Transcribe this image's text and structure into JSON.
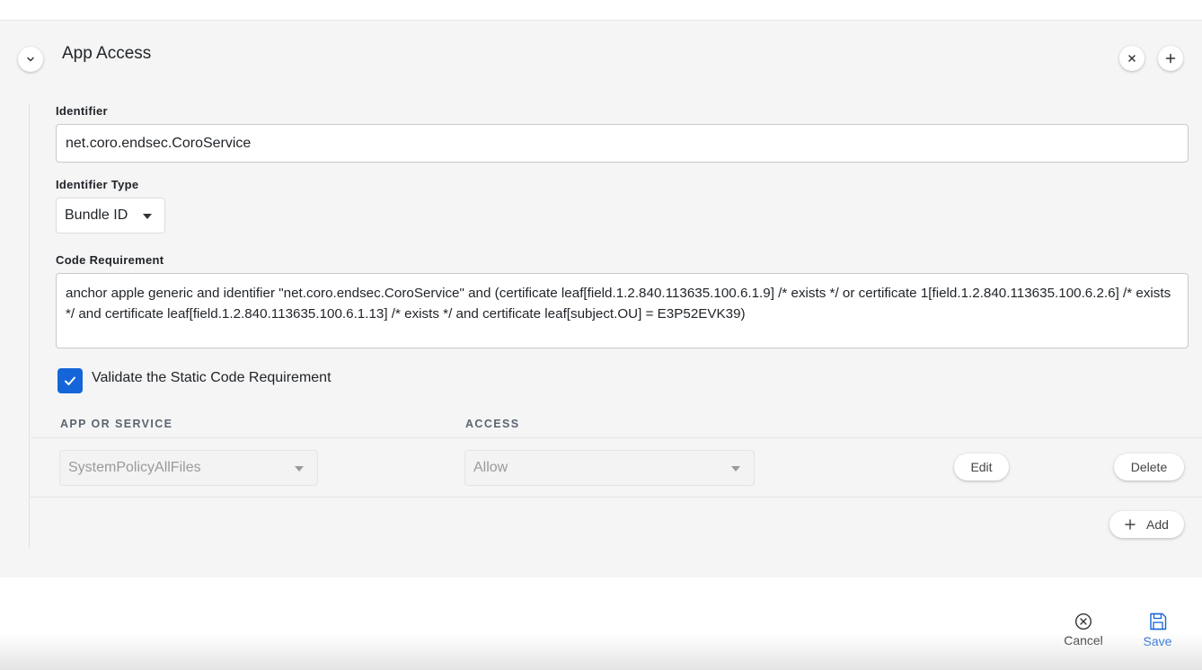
{
  "section": {
    "title": "App Access"
  },
  "identifier": {
    "label": "Identifier",
    "value": "net.coro.endsec.CoroService"
  },
  "identifier_type": {
    "label": "Identifier Type",
    "selected": "Bundle ID"
  },
  "code_requirement": {
    "label": "Code Requirement",
    "value": "anchor apple generic and identifier \"net.coro.endsec.CoroService\" and (certificate leaf[field.1.2.840.113635.100.6.1.9] /* exists */ or certificate 1[field.1.2.840.113635.100.6.2.6] /* exists */ and certificate leaf[field.1.2.840.113635.100.6.1.13] /* exists */ and certificate leaf[subject.OU] = E3P52EVK39)"
  },
  "validate": {
    "label": "Validate the Static Code Requirement",
    "checked": true
  },
  "table": {
    "col_app": "APP OR SERVICE",
    "col_access": "ACCESS",
    "rows": [
      {
        "service": "SystemPolicyAllFiles",
        "access": "Allow",
        "edit_label": "Edit",
        "delete_label": "Delete"
      }
    ],
    "add_label": "Add"
  },
  "footer": {
    "cancel_label": "Cancel",
    "save_label": "Save"
  },
  "colors": {
    "accent": "#1565d8",
    "panel_bg": "#f5f5f5"
  },
  "icons": {
    "collapse": "chevron-down-icon",
    "remove": "close-icon",
    "add_section": "plus-icon",
    "checkbox": "check-icon",
    "add": "plus-icon",
    "cancel": "circle-x-icon",
    "save": "floppy-disk-icon"
  }
}
